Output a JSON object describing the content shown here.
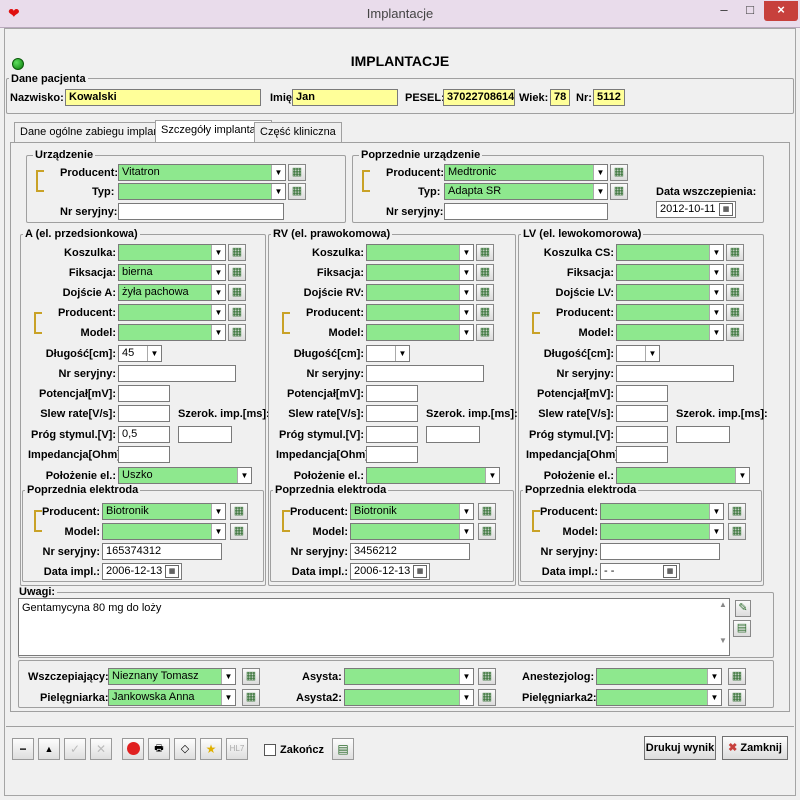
{
  "window": {
    "title": "Implantacje",
    "min": "–",
    "max": "□",
    "close": "×"
  },
  "header": {
    "title": "IMPLANTACJE"
  },
  "patient": {
    "group_title": "Dane pacjenta",
    "surname_label": "Nazwisko:",
    "surname": "Kowalski",
    "name_label": "Imię:",
    "name": "Jan",
    "pesel_label": "PESEL:",
    "pesel": "37022708614",
    "age_label": "Wiek:",
    "age": "78",
    "nr_label": "Nr:",
    "nr": "5112"
  },
  "tabs": [
    {
      "label": "Dane ogólne zabiegu implantacji"
    },
    {
      "label": "Szczegóły implantacji"
    },
    {
      "label": "Część kliniczna"
    }
  ],
  "device": {
    "title": "Urządzenie",
    "producer_label": "Producent:",
    "producer": "Vitatron",
    "type_label": "Typ:",
    "type": "",
    "serial_label": "Nr seryjny:",
    "serial": ""
  },
  "prev_device": {
    "title": "Poprzednie urządzenie",
    "producer_label": "Producent:",
    "producer": "Medtronic",
    "type_label": "Typ:",
    "type": "Adapta SR",
    "serial_label": "Nr seryjny:",
    "serial": "",
    "date_label": "Data wszczepienia:",
    "date": "2012-10-11"
  },
  "labels": {
    "potential": "Potencjał[mV]:",
    "slew": "Slew rate[V/s]:",
    "width": "Szerok. imp.[ms]:",
    "threshold": "Próg stymul.[V]:",
    "impedance": "Impedancja[Ohm]:",
    "position": "Położenie el.:",
    "length": "Długość[cm]:",
    "serial": "Nr seryjny:",
    "producer": "Producent:",
    "model": "Model:",
    "fixation": "Fiksacja:",
    "prev_title": "Poprzednia elektroda",
    "date_impl": "Data impl.:"
  },
  "leads": [
    {
      "title": "A (el. przedsionkowa)",
      "sheath_label": "Koszulka:",
      "sheath": "",
      "fixation": "bierna",
      "access_label": "Dojście A:",
      "access": "żyła pachowa",
      "producer": "",
      "model": "",
      "length": "45",
      "serial": "",
      "potential": "",
      "slew": "",
      "width": "",
      "threshold": "0,5",
      "impedance": "",
      "position": "Uszko",
      "prev": {
        "producer": "Biotronik",
        "model": "",
        "serial": "165374312",
        "date": "2006-12-13"
      }
    },
    {
      "title": "RV (el. prawokomowa)",
      "sheath_label": "Koszulka:",
      "sheath": "",
      "fixation": "",
      "access_label": "Dojście RV:",
      "access": "",
      "producer": "",
      "model": "",
      "length": "",
      "serial": "",
      "potential": "",
      "slew": "",
      "width": "",
      "threshold": "",
      "impedance": "",
      "position": "",
      "prev": {
        "producer": "Biotronik",
        "model": "",
        "serial": "3456212",
        "date": "2006-12-13"
      }
    },
    {
      "title": "LV (el. lewokomorowa)",
      "sheath_label": "Koszulka CS:",
      "sheath": "",
      "fixation": "",
      "access_label": "Dojście LV:",
      "access": "",
      "producer": "",
      "model": "",
      "length": "",
      "serial": "",
      "potential": "",
      "slew": "",
      "width": "",
      "threshold": "",
      "impedance": "",
      "position": "",
      "prev": {
        "producer": "",
        "model": "",
        "serial": "",
        "date": " - -"
      }
    }
  ],
  "notes": {
    "label": "Uwagi:",
    "text": "Gentamycyna 80 mg do loży"
  },
  "staff": {
    "implanter_label": "Wszczepiający:",
    "implanter": "Nieznany Tomasz",
    "nurse_label": "Pielęgniarka:",
    "nurse": "Jankowska Anna",
    "assistant_label": "Asysta:",
    "assistant": "",
    "assistant2_label": "Asysta2:",
    "assistant2": "",
    "anesth_label": "Anestezjolog:",
    "anesth": "",
    "nurse2_label": "Pielęgniarka2:",
    "nurse2": ""
  },
  "toolbar": {
    "hl7": "HL7",
    "finish_label": "Zakończ",
    "print_label": "Drukuj wynik",
    "close_label": "Zamknij",
    "close_x": "✖"
  },
  "colors": {
    "required": "#8ee88e",
    "patient": "#ffff99",
    "close_red": "#c7403c"
  }
}
